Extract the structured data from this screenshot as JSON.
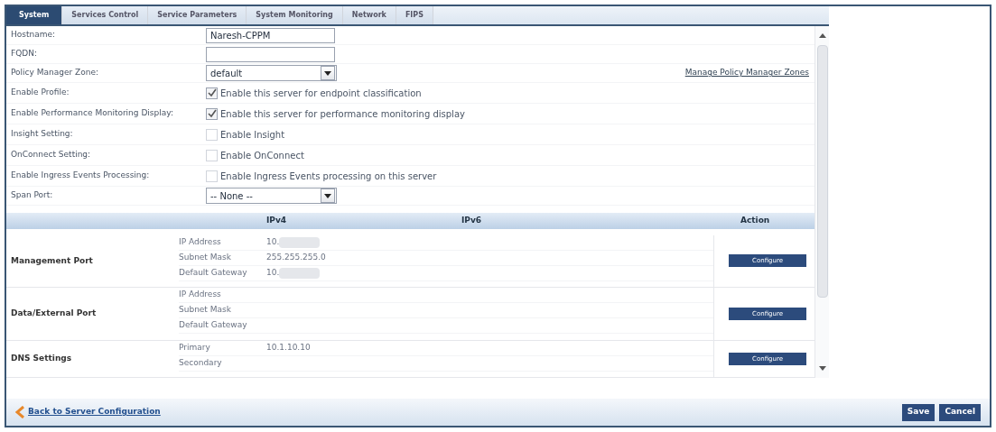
{
  "tabs": [
    {
      "label": "System",
      "selected": true
    },
    {
      "label": "Services Control",
      "selected": false
    },
    {
      "label": "Service Parameters",
      "selected": false
    },
    {
      "label": "System Monitoring",
      "selected": false
    },
    {
      "label": "Network",
      "selected": false
    },
    {
      "label": "FIPS",
      "selected": false
    }
  ],
  "form": [
    {
      "kind": "text",
      "label": "Hostname:",
      "value": "Naresh-CPPM"
    },
    {
      "kind": "text",
      "label": "FQDN:"
    },
    {
      "kind": "select",
      "label": "Policy Manager Zone:",
      "value": "default",
      "link": "Manage Policy Manager Zones"
    },
    {
      "kind": "checkbox",
      "label": "Enable Profile:",
      "text": "Enable this server for endpoint classification",
      "checked": true
    },
    {
      "kind": "checkbox",
      "label": "Enable Performance Monitoring Display:",
      "text": "Enable this server for performance monitoring display",
      "checked": true
    },
    {
      "kind": "checkbox",
      "label": "Insight Setting:",
      "text": "Enable Insight",
      "checked": false
    },
    {
      "kind": "checkbox",
      "label": "OnConnect Setting:",
      "text": "Enable OnConnect",
      "checked": false
    },
    {
      "kind": "checkbox",
      "label": "Enable Ingress Events Processing:",
      "text": "Enable Ingress Events processing on this server",
      "checked": false
    },
    {
      "kind": "select",
      "label": "Span Port:",
      "value": "-- None --"
    }
  ],
  "ports_table": {
    "columns": [
      "IPv4",
      "IPv6",
      "Action"
    ],
    "groups": [
      {
        "name": "Management Port",
        "action": "Configure",
        "rows": [
          {
            "label": "IP Address",
            "ipv4": "10.",
            "redacted": true
          },
          {
            "label": "Subnet Mask",
            "ipv4": "255.255.255.0",
            "redacted": false
          },
          {
            "label": "Default Gateway",
            "ipv4": "10.",
            "redacted": true
          }
        ]
      },
      {
        "name": "Data/External Port",
        "action": "Configure",
        "rows": [
          {
            "label": "IP Address",
            "redacted": false
          },
          {
            "label": "Subnet Mask",
            "redacted": false
          },
          {
            "label": "Default Gateway",
            "redacted": false
          }
        ]
      },
      {
        "name": "DNS Settings",
        "action": "Configure",
        "rows": [
          {
            "label": "Primary",
            "ipv4": "10.1.10.10",
            "redacted": false
          },
          {
            "label": "Secondary",
            "redacted": false
          }
        ]
      }
    ]
  },
  "back_link": "Back to Server Configuration",
  "buttons": [
    "Save",
    "Cancel"
  ]
}
